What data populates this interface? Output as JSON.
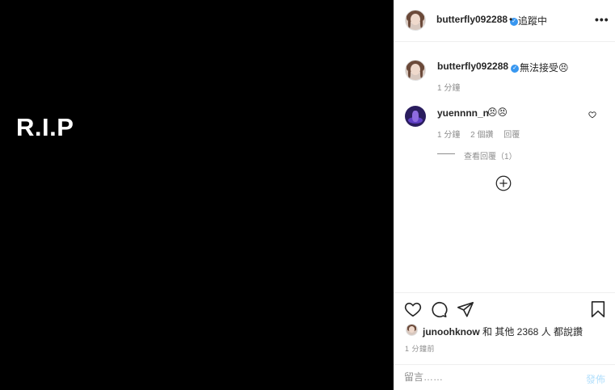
{
  "media": {
    "text": "R.I.P"
  },
  "header": {
    "username": "butterfly092288",
    "separator": "•",
    "follow_status": "追蹤中",
    "more": "•••"
  },
  "caption": {
    "username": "butterfly092288",
    "text": "無法接受😣",
    "time": "1 分鐘"
  },
  "comments": [
    {
      "username": "yuennnn_n",
      "text": "😣😣",
      "time": "1 分鐘",
      "likes": "2 個讚",
      "reply": "回覆",
      "view_replies": "查看回覆（1）"
    }
  ],
  "actions": {
    "icons": [
      "heart-icon",
      "comment-icon",
      "share-icon",
      "save-icon"
    ]
  },
  "likes": {
    "user": "junoohknow",
    "rest": " 和 其他 2368 人 都說讚"
  },
  "post_time": "1 分鐘前",
  "comment_box": {
    "placeholder": "留言……",
    "post_label": "發佈"
  },
  "colors": {
    "media_bg": "#000000",
    "verified": "#3897f0",
    "muted": "#8e8e8e",
    "post_disabled": "#b2dffc"
  }
}
